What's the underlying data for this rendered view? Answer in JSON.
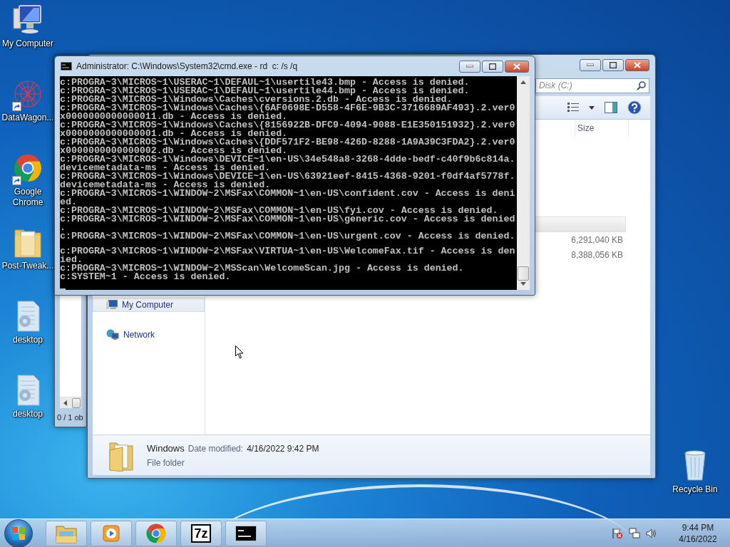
{
  "desktop_icons": [
    {
      "label": "My Computer",
      "kind": "computer",
      "shortcut": false
    },
    {
      "label": "DataWagon...",
      "kind": "mesh",
      "shortcut": true
    },
    {
      "label": "Google Chrome",
      "kind": "chrome",
      "shortcut": true
    },
    {
      "label": "Post-Tweak...",
      "kind": "folder",
      "shortcut": false
    },
    {
      "label": "desktop",
      "kind": "settings_file",
      "shortcut": false
    },
    {
      "label": "desktop",
      "kind": "settings_file",
      "shortcut": false
    }
  ],
  "recycle_bin": {
    "label": "Recycle Bin"
  },
  "back_window": {
    "status_text": "0 / 1 ob"
  },
  "explorer": {
    "search": {
      "placeholder": "Disk (C:)"
    },
    "columns": [
      "Size"
    ],
    "rows": [
      {
        "size": "6,291,040 KB"
      },
      {
        "size": "8,388,056 KB"
      }
    ],
    "nav_items": [
      {
        "label": "My Computer",
        "kind": "computer",
        "selected": true
      },
      {
        "label": "Network",
        "kind": "network",
        "selected": false
      }
    ],
    "details": {
      "name": "Windows",
      "date_label": "Date modified:",
      "date_value": "4/16/2022 9:42 PM",
      "type": "File folder"
    }
  },
  "console": {
    "title": "Administrator: C:\\Windows\\System32\\cmd.exe - rd  c: /s /q",
    "lines": [
      {
        "kind": "text",
        "text": "c:PROGRA~3\\MICROS~1\\USERAC~1\\DEFAUL~1\\usertile43.bmp - Access is denied."
      },
      {
        "kind": "text",
        "text": "c:PROGRA~3\\MICROS~1\\USERAC~1\\DEFAUL~1\\usertile44.bmp - Access is denied."
      },
      {
        "kind": "text",
        "text": "c:PROGRA~3\\MICROS~1\\Windows\\Caches\\cversions.2.db - Access is denied."
      },
      {
        "kind": "text",
        "text": "c:PROGRA~3\\MICROS~1\\Windows\\Caches\\{6AF0698E-D558-4F6E-9B3C-3716689AF493}.2.ver0"
      },
      {
        "kind": "text",
        "text": "x0000000000000011.db - Access is denied."
      },
      {
        "kind": "text",
        "text": "c:PROGRA~3\\MICROS~1\\Windows\\Caches\\{8156922B-DFC9-4094-9088-E1E350151932}.2.ver0"
      },
      {
        "kind": "text",
        "text": "x0000000000000001.db - Access is denied."
      },
      {
        "kind": "text",
        "text": "c:PROGRA~3\\MICROS~1\\Windows\\Caches\\{DDF571F2-BE98-426D-8288-1A9A39C3FDA2}.2.ver0"
      },
      {
        "kind": "text",
        "text": "x0000000000000002.db - Access is denied."
      },
      {
        "kind": "text",
        "text": "c:PROGRA~3\\MICROS~1\\Windows\\DEVICE~1\\en-US\\34e548a8-3268-4dde-bedf-c40f9b6c814a."
      },
      {
        "kind": "text",
        "text": "devicemetadata-ms - Access is denied."
      },
      {
        "kind": "text",
        "text": "c:PROGRA~3\\MICROS~1\\Windows\\DEVICE~1\\en-US\\63921eef-8415-4368-9201-f0df4af5778f."
      },
      {
        "kind": "text",
        "text": "devicemetadata-ms - Access is denied."
      },
      {
        "kind": "text",
        "text": "c:PROGRA~3\\MICROS~1\\WINDOW~2\\MSFax\\COMMON~1\\en-US\\confident.cov - Access is deni"
      },
      {
        "kind": "text",
        "text": "ed."
      },
      {
        "kind": "text",
        "text": "c:PROGRA~3\\MICROS~1\\WINDOW~2\\MSFax\\COMMON~1\\en-US\\fyi.cov - Access is denied."
      },
      {
        "kind": "text",
        "text": "c:PROGRA~3\\MICROS~1\\WINDOW~2\\MSFax\\COMMON~1\\en-US\\generic.cov - Access is denied"
      },
      {
        "kind": "text",
        "text": "."
      },
      {
        "kind": "text",
        "text": "c:PROGRA~3\\MICROS~1\\WINDOW~2\\MSFax\\COMMON~1\\en-US\\urgent.cov - Access is denied."
      },
      {
        "kind": "blank"
      },
      {
        "kind": "text",
        "text": "c:PROGRA~3\\MICROS~1\\WINDOW~2\\MSFax\\VIRTUA~1\\en-US\\WelcomeFax.tif - Access is den"
      },
      {
        "kind": "text",
        "text": "ied."
      },
      {
        "kind": "text",
        "text": "c:PROGRA~3\\MICROS~1\\WINDOW~2\\MSScan\\WelcomeScan.jpg - Access is denied."
      },
      {
        "kind": "text",
        "text": "c:SYSTEM~1 - Access is denied."
      }
    ]
  },
  "taskbar": {
    "buttons": [
      {
        "kind": "explorer"
      },
      {
        "kind": "media"
      },
      {
        "kind": "chrome"
      },
      {
        "kind": "sevenzip",
        "label": "7z"
      },
      {
        "kind": "console"
      }
    ],
    "clock": {
      "time": "9:44 PM",
      "date": "4/16/2022"
    }
  }
}
